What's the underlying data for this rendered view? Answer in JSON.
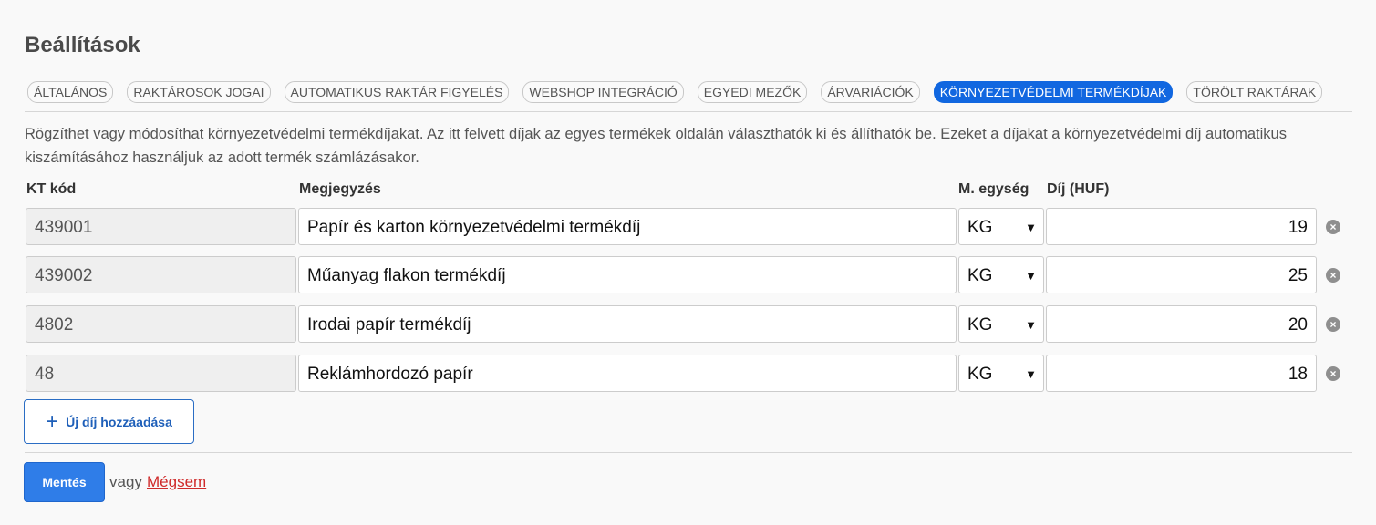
{
  "page_title": "Beállítások",
  "tabs": [
    {
      "label": "ÁLTALÁNOS",
      "active": false
    },
    {
      "label": "RAKTÁROSOK JOGAI",
      "active": false
    },
    {
      "label": "AUTOMATIKUS RAKTÁR FIGYELÉS",
      "active": false
    },
    {
      "label": "WEBSHOP INTEGRÁCIÓ",
      "active": false
    },
    {
      "label": "EGYEDI MEZŐK",
      "active": false
    },
    {
      "label": "ÁRVARIÁCIÓK",
      "active": false
    },
    {
      "label": "KÖRNYEZETVÉDELMI TERMÉKDÍJAK",
      "active": true
    },
    {
      "label": "TÖRÖLT RAKTÁRAK",
      "active": false
    }
  ],
  "description": "Rögzíthet vagy módosíthat környezetvédelmi termékdíjakat. Az itt felvett díjak az egyes termékek oldalán választhatók ki és állíthatók be. Ezeket a díjakat a környezetvédelmi díj automatikus kiszámításához használjuk az adott termék számlázásakor.",
  "columns": {
    "code": "KT kód",
    "note": "Megjegyzés",
    "unit": "M. egység",
    "fee": "Díj (HUF)"
  },
  "rows": [
    {
      "code": "439001",
      "note": "Papír és karton környezetvédelmi termékdíj",
      "unit": "KG",
      "fee": "19"
    },
    {
      "code": "439002",
      "note": "Műanyag flakon termékdíj",
      "unit": "KG",
      "fee": "25"
    },
    {
      "code": "4802",
      "note": "Irodai papír termékdíj",
      "unit": "KG",
      "fee": "20"
    },
    {
      "code": "48",
      "note": "Reklámhordozó papír",
      "unit": "KG",
      "fee": "18"
    }
  ],
  "add_button_label": "Új díj hozzáadása",
  "save_button_label": "Mentés",
  "or_text": "vagy",
  "cancel_label": "Mégsem",
  "colors": {
    "accent": "#1167e0",
    "cancel": "#cf2a2a"
  },
  "icons": {
    "add": "plus-icon",
    "remove": "remove-circle-icon",
    "select": "chevron-down-icon"
  }
}
